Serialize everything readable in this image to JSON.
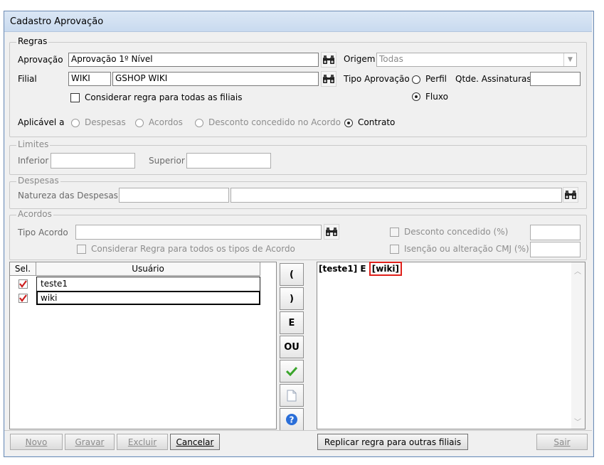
{
  "window": {
    "title": "Cadastro Aprovação"
  },
  "regras": {
    "legend": "Regras",
    "aprovacao_label": "Aprovação",
    "aprovacao_value": "Aprovação 1º Nível",
    "filial_label": "Filial",
    "filial_code": "WIKI",
    "filial_name": "GSHOP WIKI",
    "considerar_label": "Considerar regra para todas as filiais",
    "origem_label": "Origem",
    "origem_value": "Todas",
    "tipo_aprovacao_label": "Tipo Aprovação",
    "perfil_label": "Perfil",
    "fluxo_label": "Fluxo",
    "qtde_label": "Qtde. Assinaturas",
    "qtde_value": "",
    "aplicavel_label": "Aplicável a",
    "aplicavel_options": [
      "Despesas",
      "Acordos",
      "Desconto concedido no Acordo",
      "Contrato"
    ],
    "aplicavel_selected": "Contrato"
  },
  "limites": {
    "legend": "Limites",
    "inferior_label": "Inferior",
    "superior_label": "Superior",
    "inferior_value": "",
    "superior_value": ""
  },
  "despesas": {
    "legend": "Despesas",
    "natureza_label": "Natureza das Despesas",
    "code_value": "",
    "desc_value": ""
  },
  "acordos": {
    "legend": "Acordos",
    "tipo_label": "Tipo Acordo",
    "tipo_value": "",
    "considerar_tipos_label": "Considerar Regra para todos os tipos de Acordo",
    "desconto_label": "Desconto concedido (%)",
    "isencao_label": "Isenção ou alteração CMJ (%)"
  },
  "users_table": {
    "headers": {
      "sel": "Sel.",
      "usuario": "Usuário"
    },
    "rows": [
      {
        "checked": true,
        "usuario": "teste1"
      },
      {
        "checked": true,
        "usuario": "wiki"
      }
    ]
  },
  "side_buttons": {
    "open_paren": "(",
    "close_paren": ")",
    "and": "E",
    "or": "OU"
  },
  "expression": {
    "part1": "[teste1] E ",
    "part2": "[wiki]"
  },
  "footer": {
    "novo": "Novo",
    "gravar": "Gravar",
    "excluir": "Excluir",
    "cancelar": "Cancelar",
    "replicar": "Replicar regra para outras filiais",
    "sair": "Sair"
  },
  "colors": {
    "titlebar": "#c9daef",
    "highlight": "#e0201b",
    "checkmark": "#cc1f1f",
    "help": "#2a6ed8",
    "ok": "#3aa52b"
  }
}
